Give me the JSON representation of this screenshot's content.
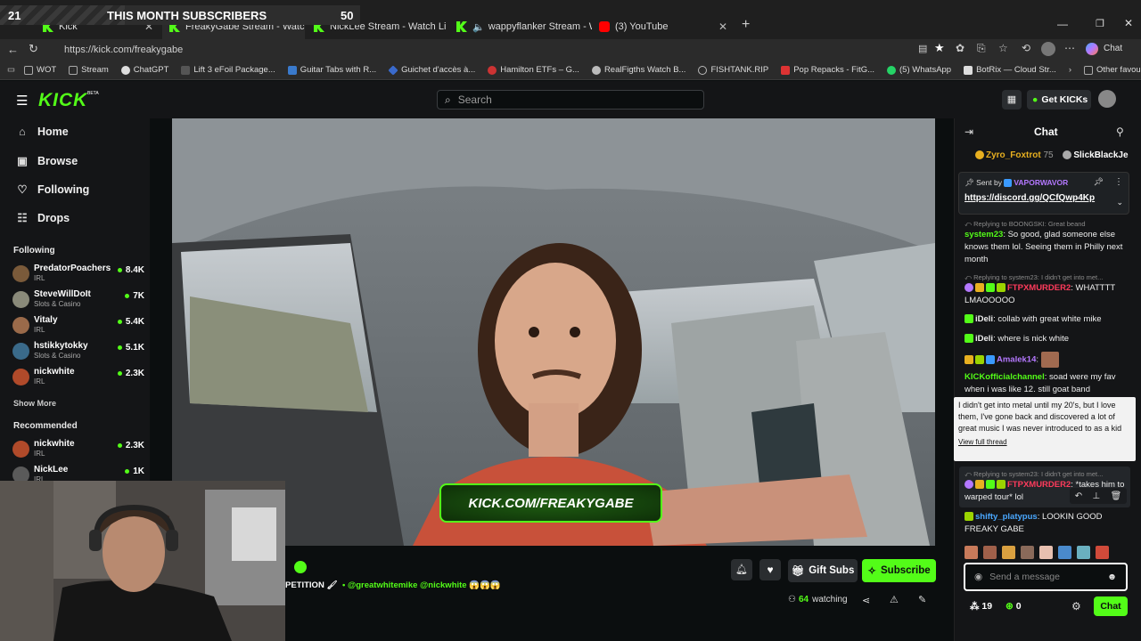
{
  "overlay": {
    "sub_count_left": "21",
    "sub_title": "THIS MONTH SUBSCRIBERS",
    "sub_count_right": "50"
  },
  "browser": {
    "tabs": [
      {
        "label": "Kick",
        "icon": "kick-icon"
      },
      {
        "label": "FreakyGabe Stream - Watch L",
        "icon": "kick-icon"
      },
      {
        "label": "NickLee Stream - Watch Live o",
        "icon": "kick-icon"
      },
      {
        "label": "wappyflanker Stream - Watch",
        "icon": "kick-icon"
      },
      {
        "label": "(3) YouTube",
        "icon": "youtube-icon"
      }
    ],
    "url": "https://kick.com/freakygabe",
    "copilot_label": "Chat",
    "bookmarks": [
      "WOT",
      "Stream",
      "ChatGPT",
      "Lift 3 eFoil Package...",
      "Guitar Tabs with R...",
      "Guichet d'accès à...",
      "Hamilton ETFs – G...",
      "RealFigths Watch B...",
      "FISHTANK.RIP",
      "Pop Repacks - FitG...",
      "(5) WhatsApp",
      "BotRix — Cloud Str..."
    ],
    "other_favourites": "Other favourites"
  },
  "kick": {
    "logo": "KICK",
    "logo_badge": "BETA",
    "search_placeholder": "Search",
    "get_kicks": "Get KICKs",
    "nav": [
      {
        "label": "Home",
        "icon": "home-icon"
      },
      {
        "label": "Browse",
        "icon": "browse-icon"
      },
      {
        "label": "Following",
        "icon": "heart-icon"
      },
      {
        "label": "Drops",
        "icon": "drops-icon"
      }
    ],
    "following_title": "Following",
    "following": [
      {
        "name": "PredatorPoachers",
        "category": "IRL",
        "viewers": "8.4K",
        "color": "#7a5a3a"
      },
      {
        "name": "SteveWillDoIt",
        "category": "Slots & Casino",
        "viewers": "7K",
        "color": "#8a8a7a"
      },
      {
        "name": "Vitaly",
        "category": "IRL",
        "viewers": "5.4K",
        "color": "#9a6a4a"
      },
      {
        "name": "hstikkytokky",
        "category": "Slots & Casino",
        "viewers": "5.1K",
        "color": "#3a6a8a"
      },
      {
        "name": "nickwhite",
        "category": "IRL",
        "viewers": "2.3K",
        "color": "#b04a2a"
      }
    ],
    "show_more": "Show More",
    "recommended_title": "Recommended",
    "recommended": [
      {
        "name": "nickwhite",
        "category": "IRL",
        "viewers": "2.3K",
        "color": "#b04a2a"
      },
      {
        "name": "NickLee",
        "category": "IRL",
        "viewers": "1K",
        "color": "#5a5a5a"
      }
    ]
  },
  "stream": {
    "overlay_url": "KICK.COM/FREAKYGABE",
    "title_fragment": "PETITION 🖌",
    "mentions": "• @greatwhitemike @nickwhite 😱😱😱",
    "gift_subs": "Gift Subs",
    "subscribe": "Subscribe",
    "watching_count": "64",
    "watching_label": "watching"
  },
  "chat": {
    "title": "Chat",
    "gifters": [
      {
        "name": "Zyro_Foxtrot",
        "amount": "75"
      },
      {
        "name": "SlickBlackJe",
        "amount": ""
      }
    ],
    "pinned": {
      "sent_by_label": "Sent by",
      "sender": "VAPORWAVOR",
      "link": "https://discord.gg/QCfQwp4Kp"
    },
    "messages": [
      {
        "reply": "Replying to BOONGSKI: Great beand",
        "user": "system23",
        "color": "#53fc18",
        "text": "So good, glad someone else knows them lol. Seeing them in Philly next month"
      },
      {
        "reply": "Replying to system23: I didn't get into met...",
        "user": "FTPXMURDER2",
        "color": "#ff3b5c",
        "text": "WHATTTT LMAOOOOO"
      },
      {
        "reply": "",
        "user": "iDeli",
        "color": "#53fc18",
        "text": "collab with great white mike"
      },
      {
        "reply": "",
        "user": "iDeli",
        "color": "#53fc18",
        "text": "where is nick white"
      },
      {
        "reply": "",
        "user": "Amalek14",
        "color": "#b478ff",
        "text": ""
      },
      {
        "reply": "",
        "user": "KICKofficialchannel",
        "color": "#53fc18",
        "text": "soad were my fav when i was like 12. still goat band"
      }
    ],
    "thread_popup": {
      "text": "I didn't get into metal until my 20's, but I love them, I've gone back and discovered a lot of great music I was never introduced to as a kid",
      "link": "View full thread"
    },
    "messages2": [
      {
        "reply": "Replying to system23: I didn't get into met...",
        "user": "FTPXMURDER2",
        "color": "#ff3b5c",
        "text": "*takes him to warped tour* lol"
      },
      {
        "reply": "",
        "user": "shifty_platypus",
        "color": "#4aa8ff",
        "text": "LOOKIN GOOD FREAKY GABE"
      }
    ],
    "input_placeholder": "Send a message",
    "kicks_count": "19",
    "points_count": "0",
    "send_label": "Chat"
  }
}
